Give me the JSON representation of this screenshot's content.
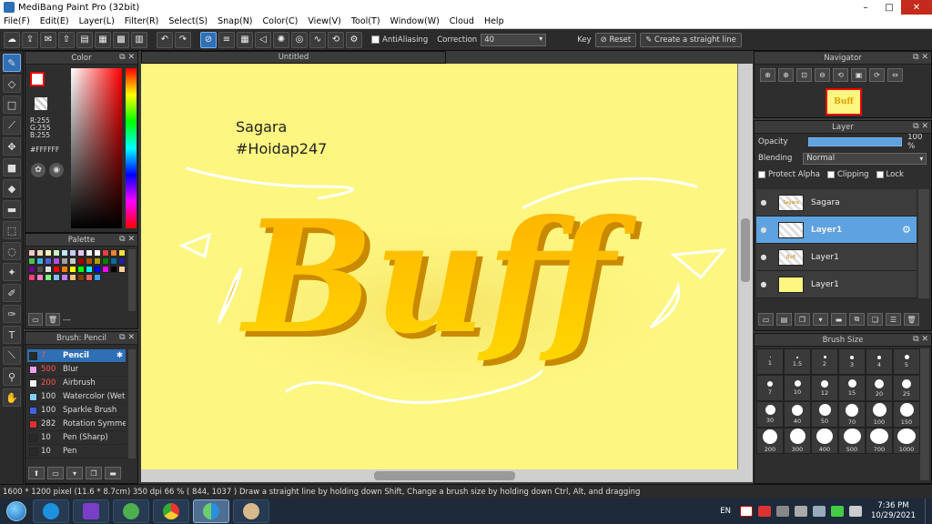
{
  "window": {
    "title": "MediBang Paint Pro (32bit)",
    "controls": {
      "minimize": "–",
      "maximize": "□",
      "close": "✕"
    }
  },
  "menu": [
    "File(F)",
    "Edit(E)",
    "Layer(L)",
    "Filter(R)",
    "Select(S)",
    "Snap(N)",
    "Color(C)",
    "View(V)",
    "Tool(T)",
    "Window(W)",
    "Cloud",
    "Help"
  ],
  "toolbar": {
    "antialiasing_label": "AntiAliasing",
    "correction_label": "Correction",
    "correction_value": "40",
    "key_label": "Key",
    "reset_label": "Reset",
    "straight_line_label": "Create a straight line"
  },
  "color_panel": {
    "title": "Color",
    "r": "R:255",
    "g": "G:255",
    "b": "B:255",
    "hex": "#FFFFFF",
    "foreground_color": "#ffffff",
    "accent_color": "#e00000"
  },
  "palette_panel": {
    "title": "Palette",
    "footer_label": "---",
    "colors": [
      "#f4c6c6",
      "#f8d9b8",
      "#f9f4b8",
      "#c9f4c0",
      "#bfe8f4",
      "#c6cdf4",
      "#e4c6f4",
      "#f4f4f4",
      "#ffffff",
      "#e04040",
      "#f08030",
      "#f0e040",
      "#50c050",
      "#40b0e0",
      "#5060e0",
      "#b050e0",
      "#a0a0a0",
      "#c8c8c8",
      "#a00000",
      "#b05000",
      "#b0a000",
      "#008000",
      "#0070a0",
      "#2020a0",
      "#700090",
      "#505050",
      "#e0e0e0",
      "#ff0000",
      "#ff8000",
      "#ffff00",
      "#00ff00",
      "#00ffff",
      "#0000ff",
      "#ff00ff",
      "#000000",
      "#ffd0a0",
      "#ff4080",
      "#ff80c0",
      "#80ff80",
      "#80c0ff",
      "#c080ff",
      "#ffc080",
      "#804000",
      "#ff6060",
      "#40a0ff"
    ]
  },
  "brush_panel": {
    "title": "Brush: Pencil",
    "brushes": [
      {
        "size": "7",
        "name": "Pencil",
        "color": "#2a2a2a"
      },
      {
        "size": "500",
        "name": "Blur",
        "color": "#f0a0f0"
      },
      {
        "size": "200",
        "name": "Airbrush",
        "color": "#f4f4f4"
      },
      {
        "size": "100",
        "name": "Watercolor (Wet)",
        "color": "#80d0f0"
      },
      {
        "size": "100",
        "name": "Sparkle Brush",
        "color": "#4060e0"
      },
      {
        "size": "282",
        "name": "Rotation Symmetry",
        "color": "#e03030"
      },
      {
        "size": "10",
        "name": "Pen (Sharp)",
        "color": "#2a2a2a"
      },
      {
        "size": "10",
        "name": "Pen",
        "color": "#2a2a2a"
      }
    ]
  },
  "canvas": {
    "tab_title": "Untitled",
    "signature_line1": "Sagara",
    "signature_line2": "#Hoidap247",
    "art_text": "Buff",
    "background_color": "#fdf681"
  },
  "navigator": {
    "title": "Navigator",
    "thumb_text": "Buff"
  },
  "layer_panel": {
    "title": "Layer",
    "opacity_label": "Opacity",
    "opacity_value": "100 %",
    "blending_label": "Blending",
    "blending_value": "Normal",
    "protect_alpha_label": "Protect Alpha",
    "clipping_label": "Clipping",
    "lock_label": "Lock",
    "layers": [
      {
        "name": "Sagara",
        "thumb": "Sagara"
      },
      {
        "name": "Layer1",
        "thumb": ""
      },
      {
        "name": "Layer1",
        "thumb": "Buff"
      },
      {
        "name": "Layer1",
        "thumb": ""
      }
    ]
  },
  "brush_size_panel": {
    "title": "Brush Size",
    "sizes": [
      "1",
      "1.5",
      "2",
      "3",
      "4",
      "5",
      "7",
      "10",
      "12",
      "15",
      "20",
      "25",
      "30",
      "40",
      "50",
      "70",
      "100",
      "150",
      "200",
      "300",
      "400",
      "500",
      "700",
      "1000"
    ]
  },
  "status": {
    "dimensions": "1600 * 1200 pixel",
    "physical": "(11.6 * 8.7cm)",
    "dpi": "350 dpi",
    "zoom": "66 %",
    "coords": "( 844, 1037 )",
    "hint": "Draw a straight line by holding down Shift, Change a brush size by holding down Ctrl, Alt, and dragging"
  },
  "taskbar": {
    "language": "EN",
    "time": "7:36 PM",
    "date": "10/29/2021"
  }
}
